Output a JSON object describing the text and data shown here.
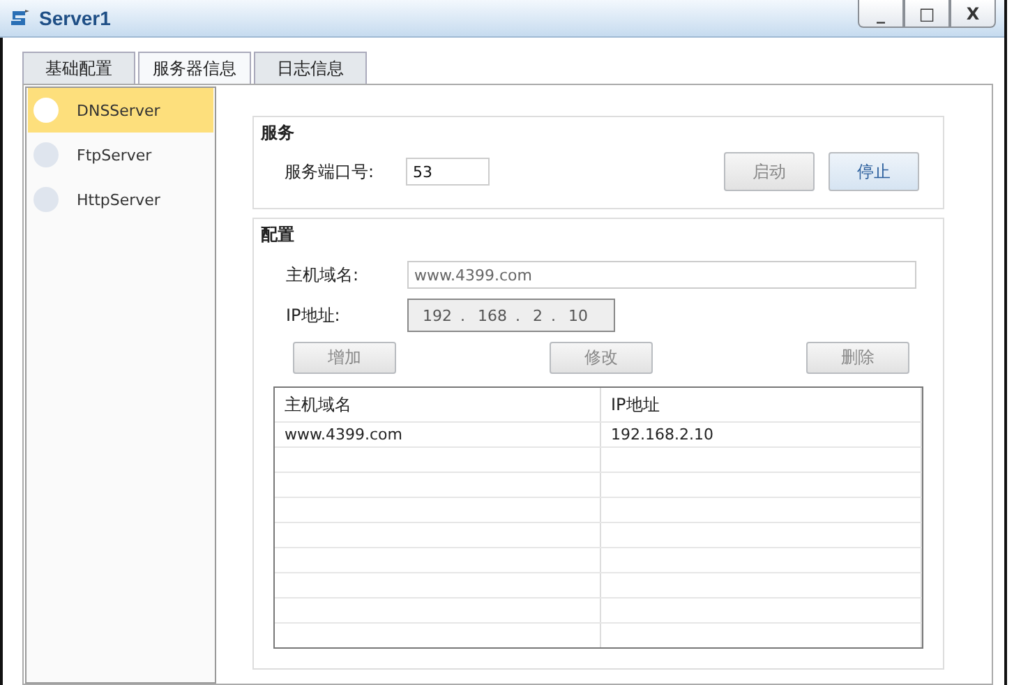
{
  "window": {
    "title": "Server1",
    "controls": [
      "_",
      "□",
      "X"
    ]
  },
  "tabs": [
    {
      "label": "基础配置",
      "selected": false
    },
    {
      "label": "服务器信息",
      "selected": true
    },
    {
      "label": "日志信息",
      "selected": false
    }
  ],
  "services": [
    {
      "label": "DNSServer",
      "selected": true
    },
    {
      "label": "FtpServer",
      "selected": false
    },
    {
      "label": "HttpServer",
      "selected": false
    }
  ],
  "service_group": {
    "title": "服务",
    "port_label": "服务端口号:",
    "port_value": "53",
    "buttons": [
      {
        "label": "启动",
        "disabled": true
      },
      {
        "label": "停止",
        "disabled": false
      }
    ]
  },
  "config_group": {
    "title": "配置",
    "host_label": "主机域名:",
    "host_value": "www.4399.com",
    "ip_label": "IP地址:",
    "ip_octets": [
      "192",
      "168",
      "2",
      "10"
    ],
    "ip_separators": [
      ".",
      ".",
      "."
    ],
    "buttons": [
      {
        "label": "增加",
        "disabled": true
      },
      {
        "label": "修改",
        "disabled": true
      },
      {
        "label": "删除",
        "disabled": true
      }
    ]
  },
  "table": {
    "columns": [
      "主机域名",
      "IP地址"
    ],
    "rows": [
      [
        "www.4399.com",
        "192.168.2.10"
      ]
    ]
  }
}
